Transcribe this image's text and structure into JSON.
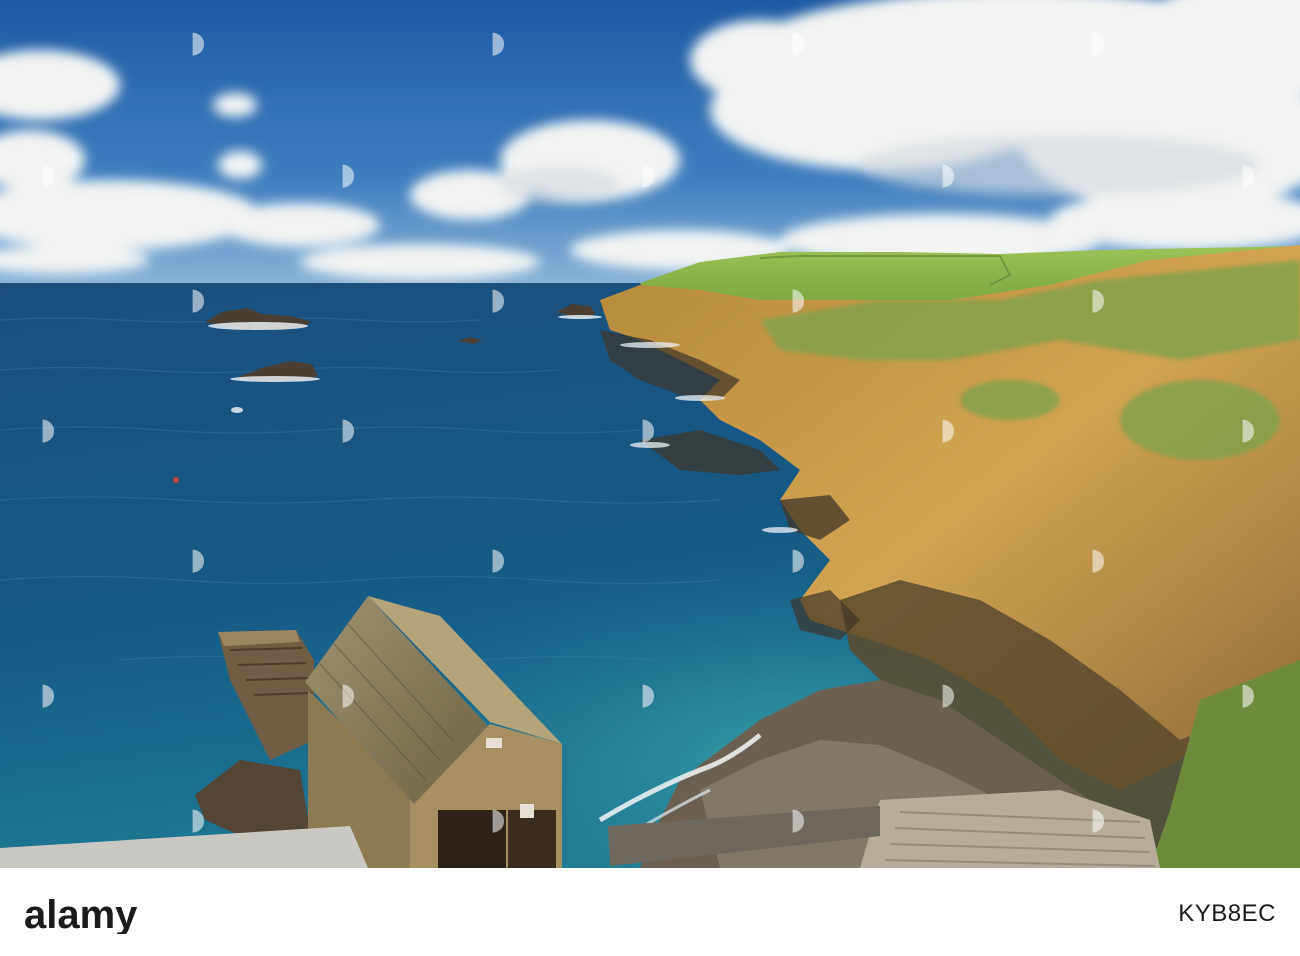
{
  "photo": {
    "subject": "coastal-cliffs-with-lifeboat-station",
    "colors": {
      "sky_top": "#1f5fa8",
      "sky_horizon": "#8fb7d8",
      "sea_deep": "#134d7c",
      "sea_shallow": "#2a8aa0",
      "cliff_sunlit": "#c7963f",
      "cliff_shadow": "#5b4a2e",
      "grass": "#8fb54a",
      "roof": "#8a7d5c",
      "cloud": "#f4f4f2"
    }
  },
  "watermark": {
    "brand": "alamy"
  },
  "footer": {
    "logo_text": "alamy",
    "image_id": "KYB8EC"
  }
}
